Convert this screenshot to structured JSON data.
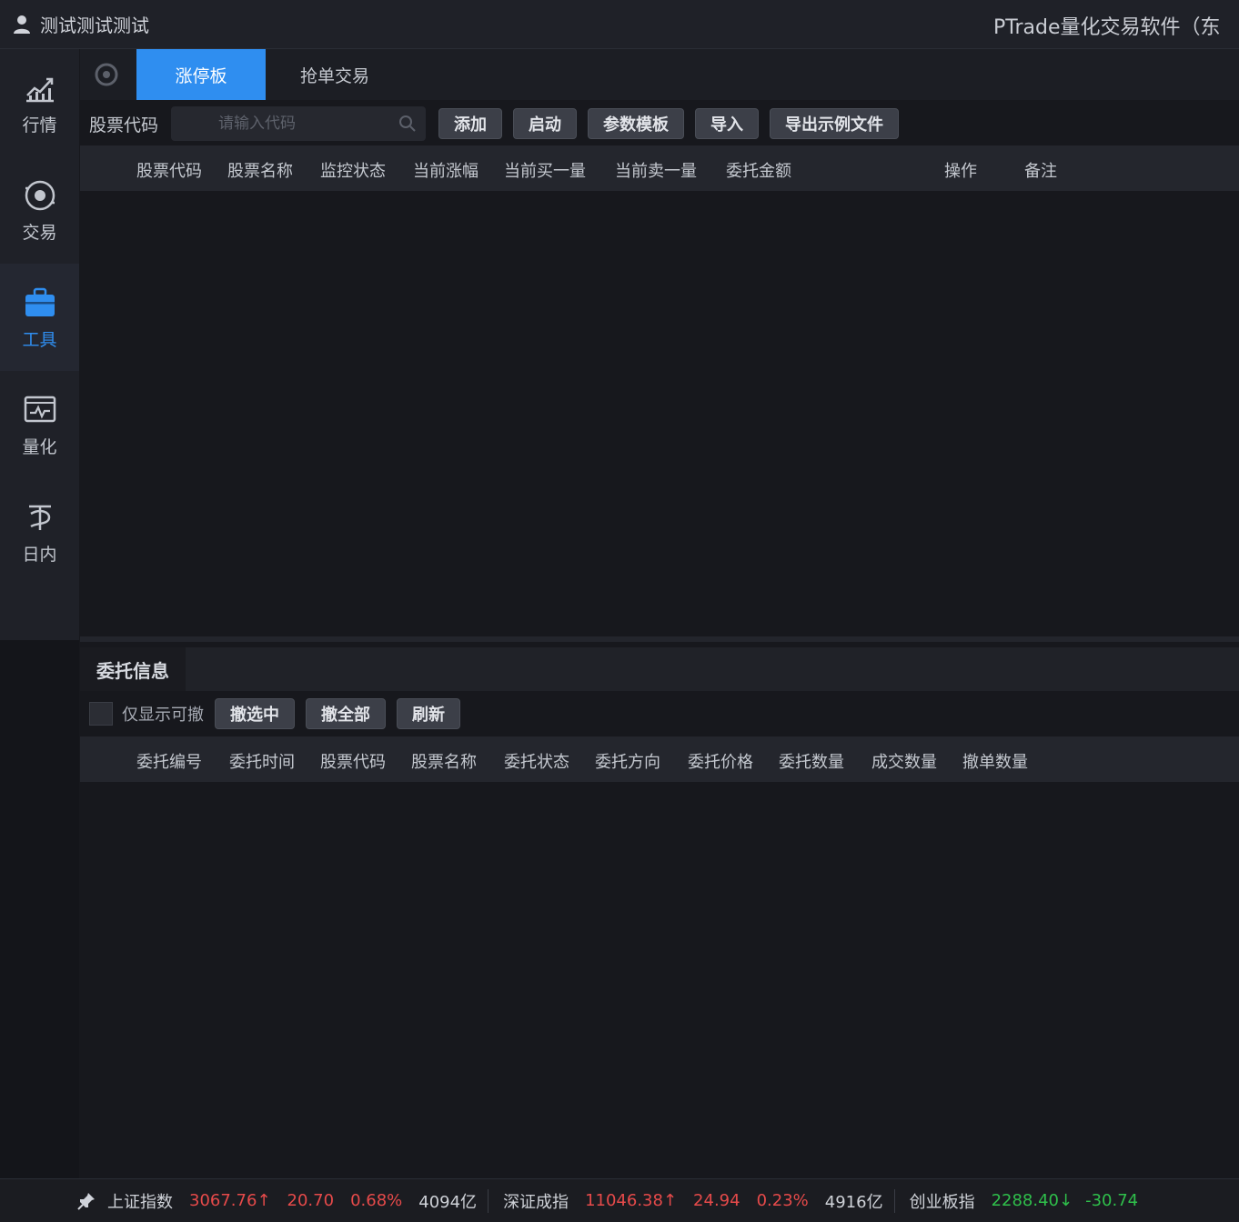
{
  "titlebar": {
    "user_name": "测试测试测试",
    "app_title": "PTrade量化交易软件（东"
  },
  "sidebar": {
    "items": [
      {
        "label": "行情",
        "icon": "chart-icon"
      },
      {
        "label": "交易",
        "icon": "trade-icon"
      },
      {
        "label": "工具",
        "icon": "briefcase-icon"
      },
      {
        "label": "量化",
        "icon": "quant-monitor-icon"
      },
      {
        "label": "日内",
        "icon": "intraday-icon"
      }
    ],
    "active_index": 2,
    "accent": "#2f8ef0"
  },
  "tabs": [
    {
      "label": "涨停板",
      "active": true
    },
    {
      "label": "抢单交易",
      "active": false
    }
  ],
  "toolbar": {
    "code_label": "股票代码",
    "search_placeholder": "请输入代码",
    "buttons": [
      "添加",
      "启动",
      "参数模板",
      "导入",
      "导出示例文件"
    ]
  },
  "monitor_table": {
    "columns": [
      "股票代码",
      "股票名称",
      "监控状态",
      "当前涨幅",
      "当前买一量",
      "当前卖一量",
      "委托金额",
      "操作",
      "备注"
    ],
    "rows": []
  },
  "orders": {
    "title": "委托信息",
    "only_cancelable_label": "仅显示可撤",
    "buttons": [
      "撤选中",
      "撤全部",
      "刷新"
    ],
    "columns": [
      "委托编号",
      "委托时间",
      "股票代码",
      "股票名称",
      "委托状态",
      "委托方向",
      "委托价格",
      "委托数量",
      "成交数量",
      "撤单数量"
    ],
    "rows": []
  },
  "statusbar": {
    "indices": [
      {
        "name": "上证指数",
        "price": "3067.76",
        "arrow": "↑",
        "change": "20.70",
        "pct": "0.68%",
        "volume": "4094亿",
        "direction": "up"
      },
      {
        "name": "深证成指",
        "price": "11046.38",
        "arrow": "↑",
        "change": "24.94",
        "pct": "0.23%",
        "volume": "4916亿",
        "direction": "up"
      },
      {
        "name": "创业板指",
        "price": "2288.40",
        "arrow": "↓",
        "change": "-30.74",
        "pct": "",
        "volume": "",
        "direction": "down"
      }
    ],
    "up_color": "#e64a4a",
    "down_color": "#2fbf4b"
  }
}
